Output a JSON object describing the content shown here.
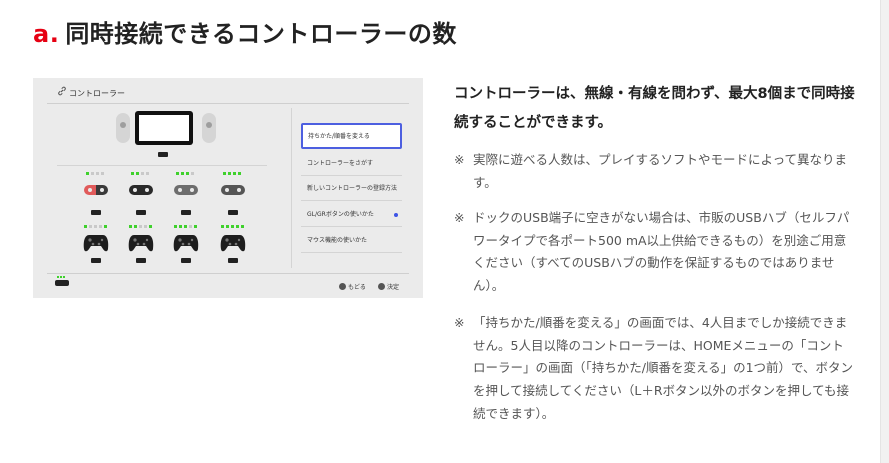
{
  "heading": {
    "marker": "a.",
    "title": "同時接続できるコントローラーの数"
  },
  "screenshot": {
    "title": "コントローラー",
    "menu": [
      "持ちかた/順番を変える",
      "コントローラーをさがす",
      "新しいコントローラーの登録方法",
      "GL/GRボタンの使いかた",
      "マウス機能の使いかた"
    ],
    "footer": {
      "back": "もどる",
      "ok": "決定"
    },
    "joycon_slots": [
      {
        "leds": [
          true,
          false,
          false,
          false
        ],
        "color_left": "#e05a5a",
        "color_right": "#3a3a3a"
      },
      {
        "leds": [
          true,
          true,
          false,
          false
        ],
        "color_left": "#2a2a2a",
        "color_right": "#2a2a2a"
      },
      {
        "leds": [
          true,
          true,
          true,
          false
        ],
        "color_left": "#6d6d6d",
        "color_right": "#6d6d6d"
      },
      {
        "leds": [
          true,
          true,
          true,
          true
        ],
        "color_left": "#555555",
        "color_right": "#555555"
      }
    ],
    "pro_slots": [
      {
        "leds": [
          true,
          false,
          false,
          false,
          true
        ]
      },
      {
        "leds": [
          true,
          true,
          false,
          false,
          true
        ]
      },
      {
        "leds": [
          true,
          true,
          true,
          false,
          true
        ]
      },
      {
        "leds": [
          true,
          true,
          true,
          true,
          true
        ]
      }
    ],
    "colors": {
      "led_on": "#3fd12c",
      "led_off": "#c9c9c9",
      "selection": "#4d5fe0"
    }
  },
  "intro": "コントローラーは、無線・有線を問わず、最大8個まで同時接続することができます。",
  "notes": [
    {
      "mark": "※",
      "text": "実際に遊べる人数は、プレイするソフトやモードによって異なります。"
    },
    {
      "mark": "※",
      "text": "ドックのUSB端子に空きがない場合は、市販のUSBハブ（セルフパワータイプで各ポート500 mA以上供給できるもの）を別途ご用意ください（すべてのUSBハブの動作を保証するものではありません）。"
    },
    {
      "mark": "※",
      "text": "「持ちかた/順番を変える」の画面では、4人目までしか接続できません。5人目以降のコントローラーは、HOMEメニューの「コントローラー」の画面（「持ちかた/順番を変える」の1つ前）で、ボタンを押して接続してください（L＋Rボタン以外のボタンを押しても接続できます）。"
    }
  ],
  "accent_color": "#e60012"
}
